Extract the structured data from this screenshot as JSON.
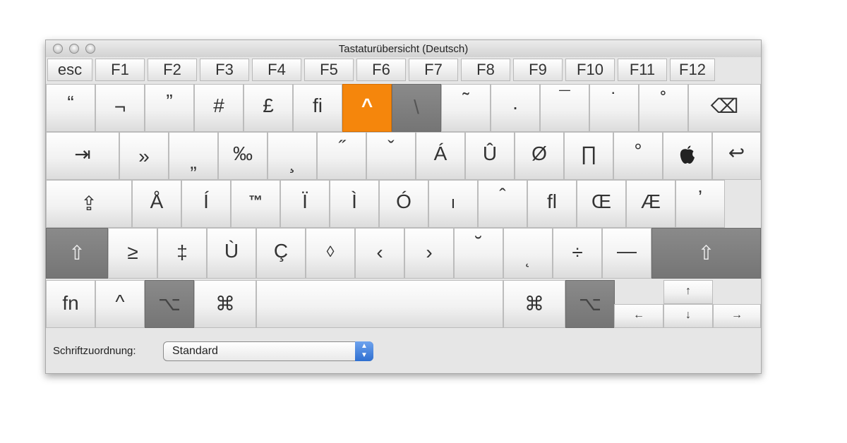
{
  "window": {
    "title": "Tastaturübersicht (Deutsch)"
  },
  "function_row": [
    "esc",
    "F1",
    "F2",
    "F3",
    "F4",
    "F5",
    "F6",
    "F7",
    "F8",
    "F9",
    "F10",
    "F11",
    "F12"
  ],
  "rows": {
    "row1": [
      "“",
      "¬",
      "”",
      "#",
      "£",
      "ﬁ",
      "^",
      "\\",
      "˜",
      "·",
      "¯",
      "˙",
      "˚",
      "⌫"
    ],
    "row2": [
      "⇥",
      "»",
      "„",
      "‰",
      "¸",
      "˝",
      "ˇ",
      "Á",
      "Û",
      "Ø",
      "∏",
      "°",
      "",
      "↩"
    ],
    "row3": [
      "⇪",
      "Å",
      "Í",
      "™",
      "Ï",
      "Ì",
      "Ó",
      "ı",
      "ˆ",
      "ﬂ",
      "Œ",
      "Æ",
      "’"
    ],
    "row4": [
      "⇧",
      "≥",
      "‡",
      "Ù",
      "Ç",
      "◊",
      "‹",
      "›",
      "˘",
      "˛",
      "÷",
      "—",
      "⇧"
    ],
    "row5": [
      "fn",
      "^",
      "⌥",
      "⌘",
      "",
      "⌘",
      "⌥"
    ],
    "arrows": [
      "↑",
      "←",
      "↓",
      "→"
    ]
  },
  "footer": {
    "label": "Schriftzuordnung:",
    "select_value": "Standard",
    "select_icon": "stepper-arrows-icon"
  },
  "colors": {
    "highlight": "#f5860c",
    "modifier_dark": "#7f7f7f",
    "window_bg": "#e6e6e6"
  }
}
